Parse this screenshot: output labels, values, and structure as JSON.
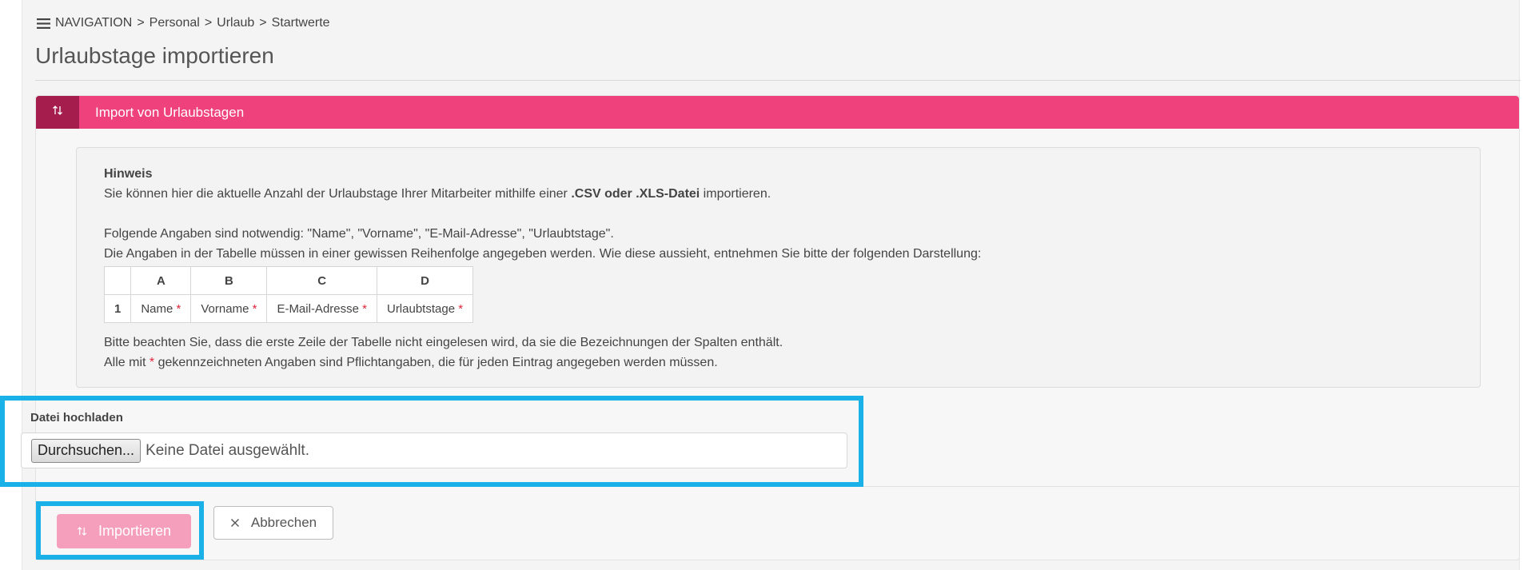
{
  "breadcrumb": {
    "nav_label": "NAVIGATION",
    "separator": ">",
    "items": [
      "Personal",
      "Urlaub",
      "Startwerte"
    ]
  },
  "page": {
    "title": "Urlaubstage importieren"
  },
  "card": {
    "header_icon": "sort-arrows-icon",
    "header_title": "Import von Urlaubstagen"
  },
  "hint": {
    "heading": "Hinweis",
    "intro_prefix": "Sie können hier die aktuelle Anzahl der Urlaubstage Ihrer Mitarbeiter mithilfe einer ",
    "intro_bold": ".CSV oder .XLS-Datei",
    "intro_suffix": " importieren.",
    "required_fields": "Folgende Angaben sind notwendig: \"Name\", \"Vorname\", \"E-Mail-Adresse\", \"Urlaubtstage\".",
    "order_note": "Die Angaben in der Tabelle müssen in einer gewissen Reihenfolge angegeben werden. Wie diese aussieht, entnehmen Sie bitte der folgenden Darstellung:",
    "table": {
      "columns": [
        "A",
        "B",
        "C",
        "D"
      ],
      "row_number": "1",
      "cells": [
        "Name",
        "Vorname",
        "E-Mail-Adresse",
        "Urlaubtstage"
      ],
      "required_marker": "*"
    },
    "first_row_note": "Bitte beachten Sie, dass die erste Zeile der Tabelle nicht eingelesen wird, da sie die Bezeichnungen der Spalten enthält.",
    "mandatory_prefix": "Alle mit ",
    "mandatory_marker": "*",
    "mandatory_suffix": " gekennzeichneten Angaben sind Pflichtangaben, die für jeden Eintrag angegeben werden müssen."
  },
  "upload": {
    "label": "Datei hochladen",
    "browse_label": "Durchsuchen...",
    "status": "Keine Datei ausgewählt."
  },
  "actions": {
    "import_label": "Importieren",
    "import_icon": "sort-arrows-icon",
    "cancel_label": "Abbrechen",
    "cancel_icon": "close-icon"
  },
  "colors": {
    "header": "#ef417c",
    "header_icon_box": "#a51d4d",
    "import_button": "#f59fbc",
    "highlight": "#1ab1e8",
    "required": "#e2253c"
  }
}
